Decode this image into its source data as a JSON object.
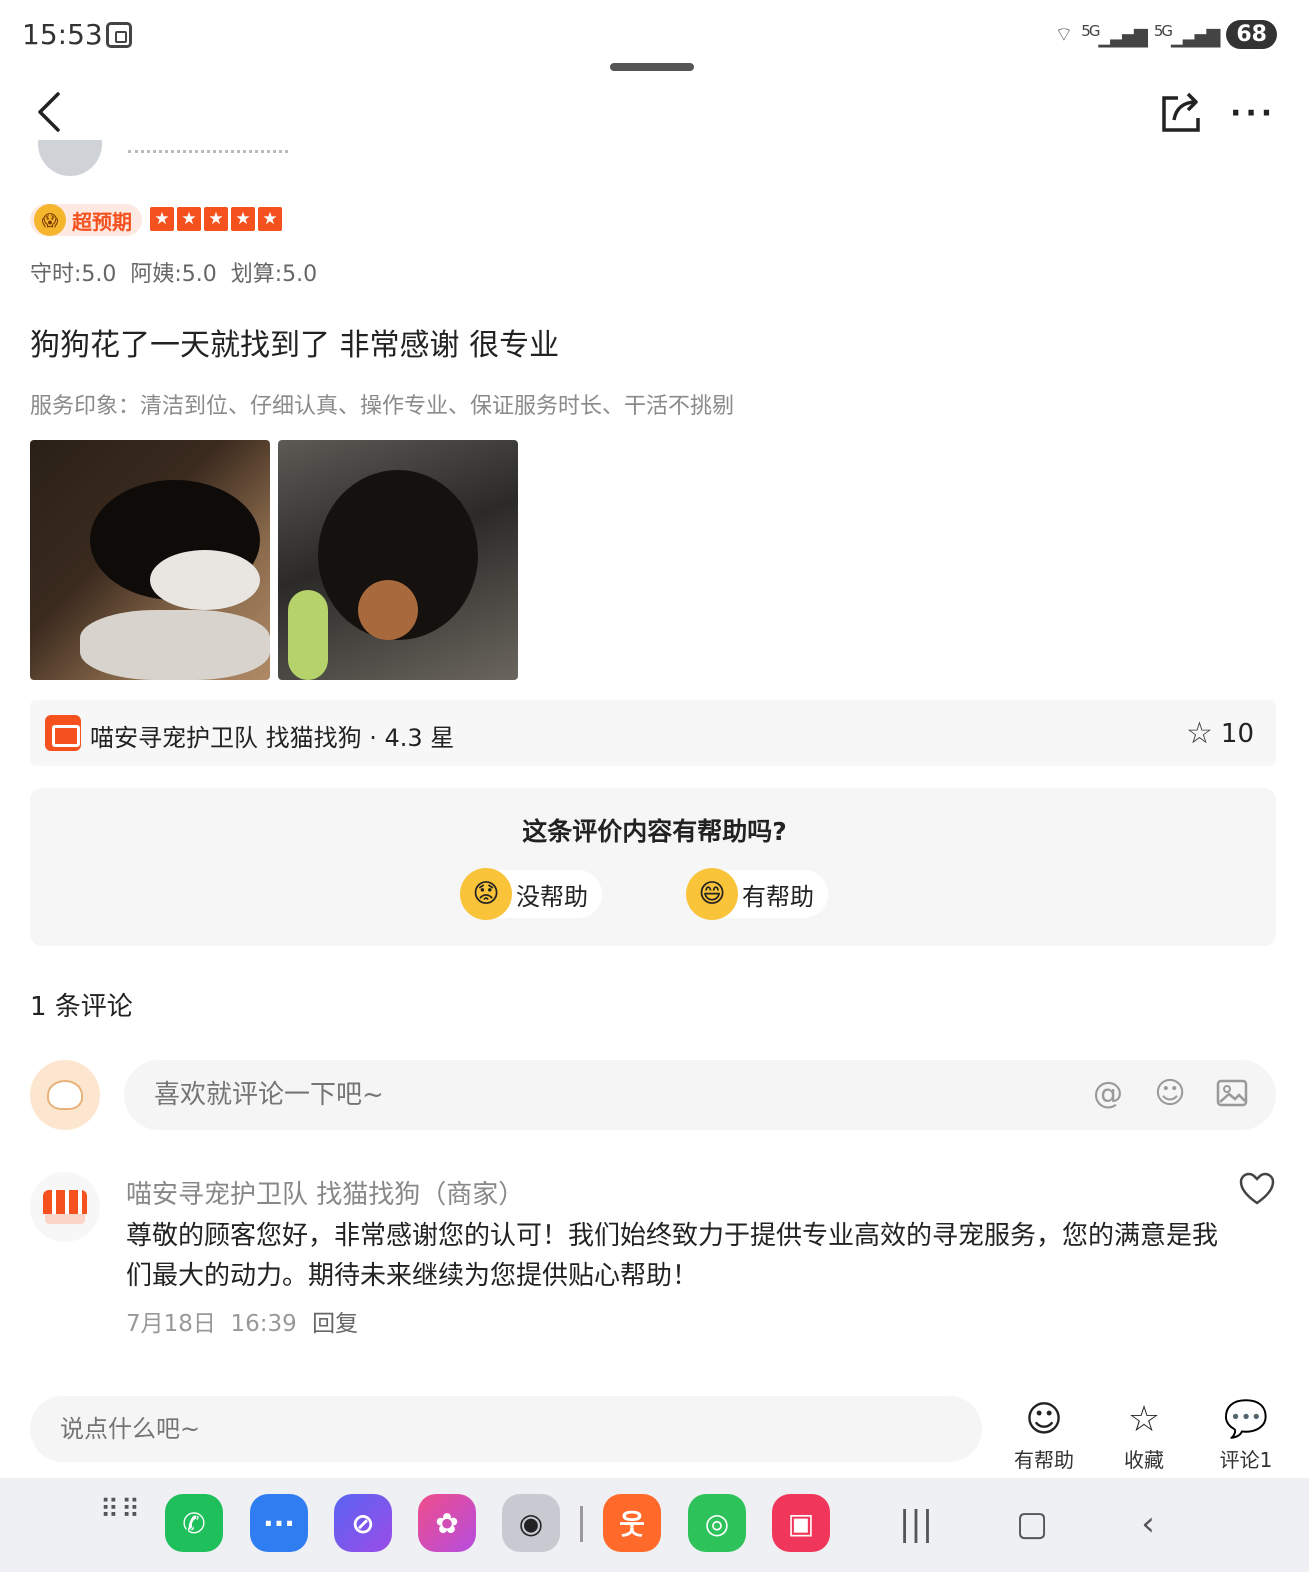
{
  "status": {
    "time": "15:53",
    "signal1": "5G",
    "signal2": "5G",
    "battery": "68"
  },
  "rating": {
    "badge": "超预期",
    "stars": [
      "★",
      "★",
      "★",
      "★",
      "★"
    ],
    "scores": "守时:5.0  阿姨:5.0  划算:5.0"
  },
  "review": {
    "text": "狗狗花了一天就找到了 非常感谢 很专业",
    "impression": "服务印象：清洁到位、仔细认真、操作专业、保证服务时长、干活不挑剔"
  },
  "shop": {
    "name": "喵安寻宠护卫队 找猫找狗 · 4.3 星",
    "fav_count": "10"
  },
  "helpful": {
    "question": "这条评价内容有帮助吗?",
    "no_help": "没帮助",
    "help": "有帮助"
  },
  "comments": {
    "count_label": "1 条评论",
    "input_placeholder": "喜欢就评论一下吧~",
    "items": [
      {
        "author": "喵安寻宠护卫队 找猫找狗（商家）",
        "text": "尊敬的顾客您好，非常感谢您的认可！我们始终致力于提供专业高效的寻宠服务，您的满意是我们最大的动力。期待未来继续为您提供贴心帮助！",
        "date": "7月18日  16:39",
        "reply_label": "回复"
      }
    ]
  },
  "bottom_bar": {
    "input_placeholder": "说点什么吧~",
    "helpful_label": "有帮助",
    "fav_label": "收藏",
    "comment_label": "评论1"
  },
  "colors": {
    "accent": "#f4511e",
    "star": "#f4511e"
  }
}
